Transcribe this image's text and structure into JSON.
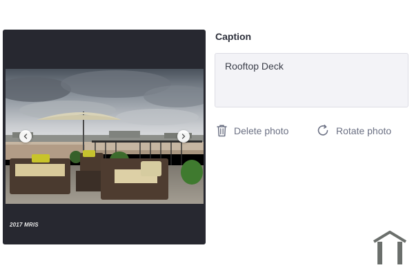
{
  "viewer": {
    "watermark": "2017 MRIS",
    "prev_icon": "chevron-left-icon",
    "next_icon": "chevron-right-icon"
  },
  "caption": {
    "label": "Caption",
    "value": "Rooftop Deck"
  },
  "actions": {
    "delete": {
      "label": "Delete photo",
      "icon": "trash-icon"
    },
    "rotate": {
      "label": "Rotate photo",
      "icon": "rotate-icon"
    }
  },
  "logo": {
    "icon": "house-outline-icon"
  },
  "colors": {
    "viewer_bg": "#272830",
    "caption_bg": "#f3f3f7",
    "action_text": "#6b7083",
    "logo": "#6b6f6c"
  }
}
